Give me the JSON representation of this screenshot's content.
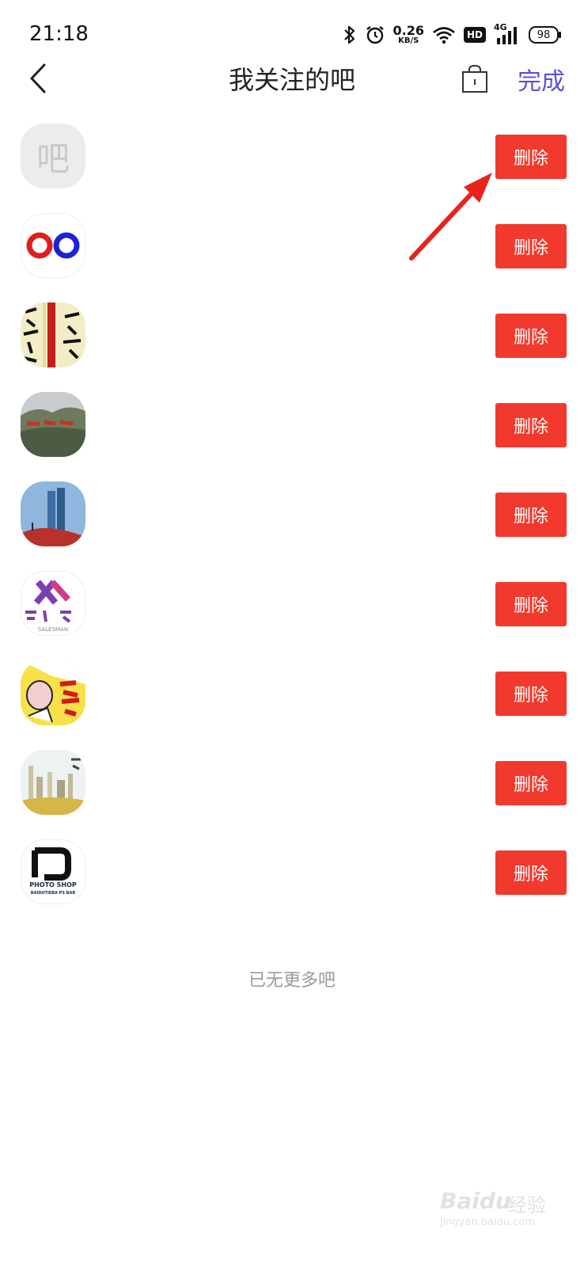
{
  "status_bar": {
    "time": "21:18",
    "speed_value": "0.26",
    "speed_unit": "KB/S",
    "hd": "HD",
    "network": "4G",
    "battery": "98"
  },
  "header": {
    "title": "我关注的吧",
    "done_label": "完成"
  },
  "list": {
    "delete_label": "删除",
    "items": [
      {
        "icon": "placeholder",
        "placeholder_char": "吧"
      },
      {
        "icon": "rings"
      },
      {
        "icon": "calligraphy"
      },
      {
        "icon": "landscape"
      },
      {
        "icon": "skyscraper"
      },
      {
        "icon": "salesman",
        "logo_text": "SALESMAN"
      },
      {
        "icon": "comic"
      },
      {
        "icon": "city"
      },
      {
        "icon": "photoshop",
        "logo_text": "PHOTO SHOP",
        "logo_subtext": "BAIDUTIEBA PS BAR"
      }
    ]
  },
  "footer": {
    "end_text": "已无更多吧"
  },
  "watermark": {
    "brand": "Baidu",
    "text": "经验",
    "url": "jingyan.baidu.com"
  },
  "colors": {
    "delete": "#f2392d",
    "done": "#5b52d6",
    "annotation_arrow": "#e8231e"
  }
}
